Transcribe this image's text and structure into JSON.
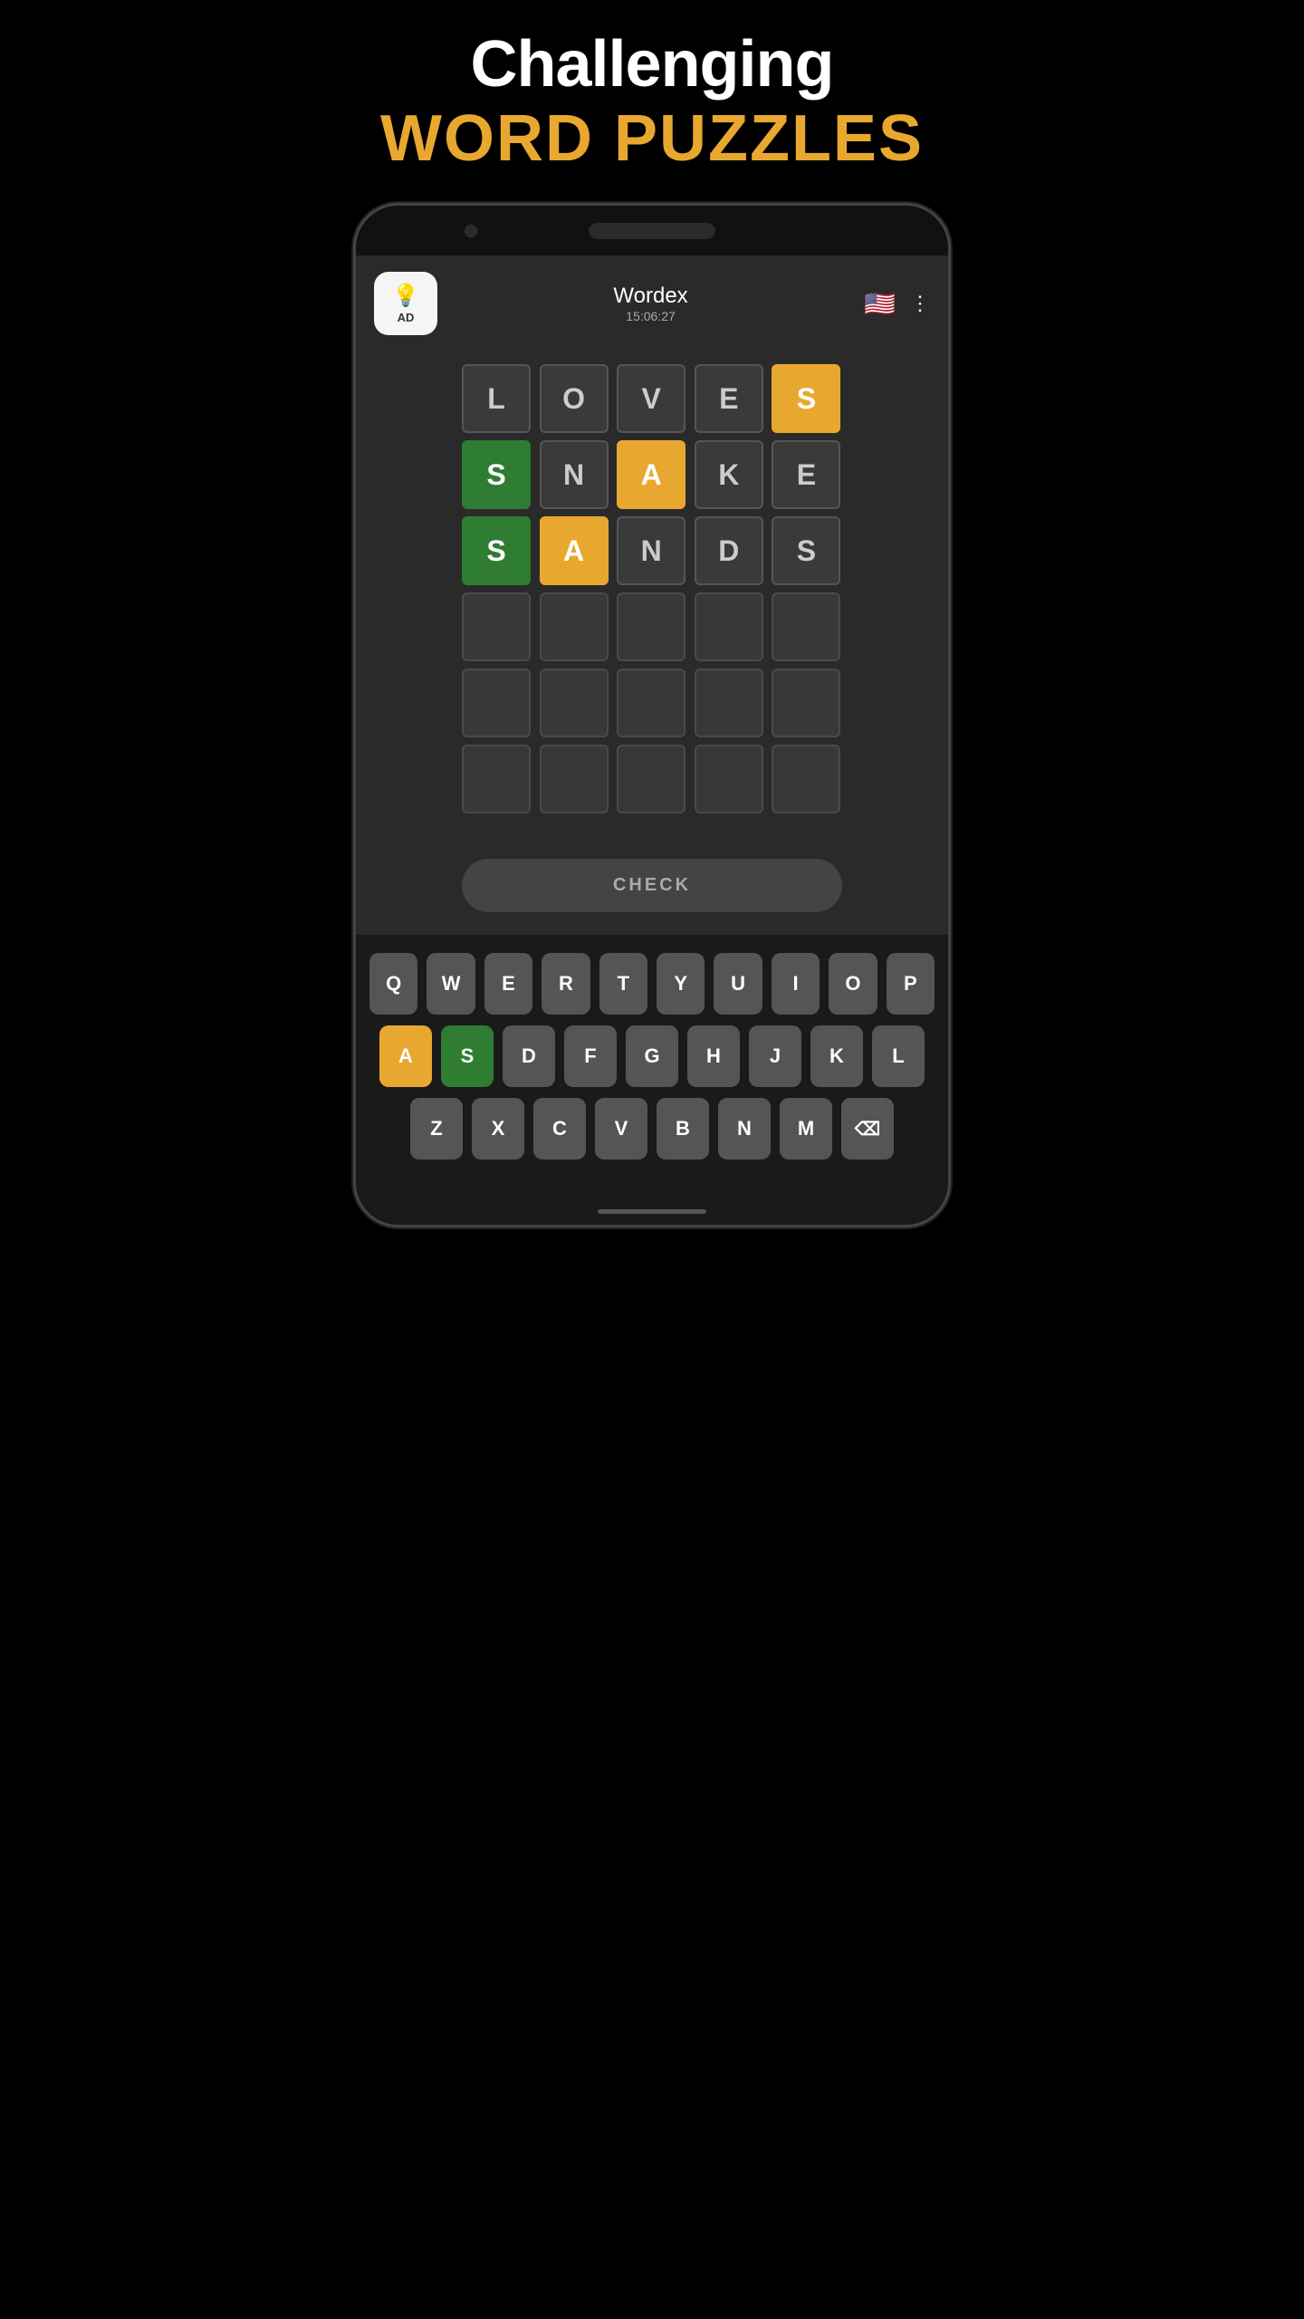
{
  "header": {
    "challenging": "Challenging",
    "word_puzzles": "WORD PUZZLES"
  },
  "app": {
    "title": "Wordex",
    "timer": "15:06:27",
    "ad_label": "AD"
  },
  "grid": {
    "rows": [
      [
        {
          "letter": "L",
          "state": "normal"
        },
        {
          "letter": "O",
          "state": "normal"
        },
        {
          "letter": "V",
          "state": "normal"
        },
        {
          "letter": "E",
          "state": "normal"
        },
        {
          "letter": "S",
          "state": "yellow"
        }
      ],
      [
        {
          "letter": "S",
          "state": "green"
        },
        {
          "letter": "N",
          "state": "normal"
        },
        {
          "letter": "A",
          "state": "yellow"
        },
        {
          "letter": "K",
          "state": "normal"
        },
        {
          "letter": "E",
          "state": "normal"
        }
      ],
      [
        {
          "letter": "S",
          "state": "green"
        },
        {
          "letter": "A",
          "state": "yellow"
        },
        {
          "letter": "N",
          "state": "normal"
        },
        {
          "letter": "D",
          "state": "normal"
        },
        {
          "letter": "S",
          "state": "normal"
        }
      ],
      [
        {
          "letter": "",
          "state": "empty"
        },
        {
          "letter": "",
          "state": "empty"
        },
        {
          "letter": "",
          "state": "empty"
        },
        {
          "letter": "",
          "state": "empty"
        },
        {
          "letter": "",
          "state": "empty"
        }
      ],
      [
        {
          "letter": "",
          "state": "empty"
        },
        {
          "letter": "",
          "state": "empty"
        },
        {
          "letter": "",
          "state": "empty"
        },
        {
          "letter": "",
          "state": "empty"
        },
        {
          "letter": "",
          "state": "empty"
        }
      ],
      [
        {
          "letter": "",
          "state": "empty"
        },
        {
          "letter": "",
          "state": "empty"
        },
        {
          "letter": "",
          "state": "empty"
        },
        {
          "letter": "",
          "state": "empty"
        },
        {
          "letter": "",
          "state": "empty"
        }
      ]
    ]
  },
  "check_button": {
    "label": "CHECK"
  },
  "keyboard": {
    "row1": [
      "Q",
      "W",
      "E",
      "R",
      "T",
      "Y",
      "U",
      "I",
      "O",
      "P"
    ],
    "row2": [
      "A",
      "S",
      "D",
      "F",
      "G",
      "H",
      "J",
      "K",
      "L"
    ],
    "row3": [
      "Z",
      "X",
      "C",
      "V",
      "B",
      "N",
      "M",
      "⌫"
    ],
    "colored_keys": {
      "A": "yellow",
      "S": "green"
    }
  }
}
